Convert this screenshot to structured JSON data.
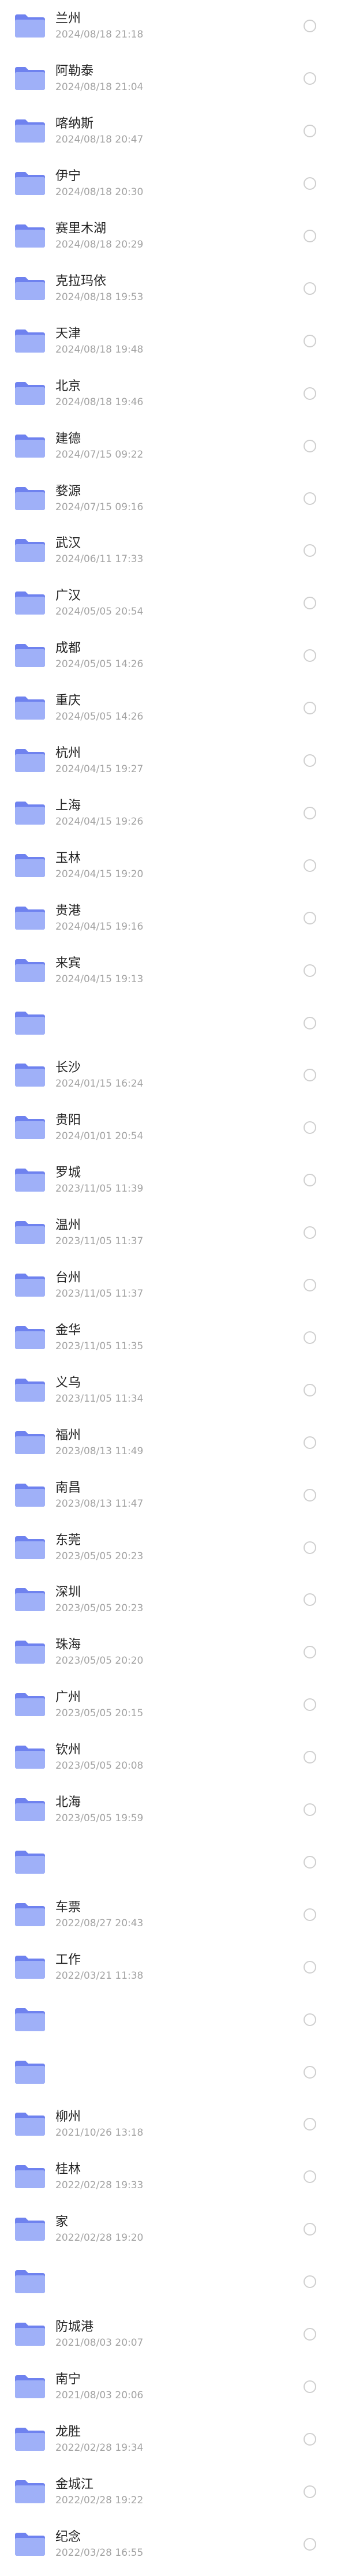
{
  "colors": {
    "folder_back": "#6f82ef",
    "folder_front": "#9fb0f8",
    "title": "#222222",
    "date": "#a3a3a3",
    "radio": "#cfcfcf"
  },
  "items": [
    {
      "name": "兰州",
      "date": "2024/08/18 21:18"
    },
    {
      "name": "阿勒泰",
      "date": "2024/08/18 21:04"
    },
    {
      "name": "喀纳斯",
      "date": "2024/08/18 20:47"
    },
    {
      "name": "伊宁",
      "date": "2024/08/18 20:30"
    },
    {
      "name": "赛里木湖",
      "date": "2024/08/18 20:29"
    },
    {
      "name": "克拉玛依",
      "date": "2024/08/18 19:53"
    },
    {
      "name": "天津",
      "date": "2024/08/18 19:48"
    },
    {
      "name": "北京",
      "date": "2024/08/18 19:46"
    },
    {
      "name": "建德",
      "date": "2024/07/15 09:22"
    },
    {
      "name": "婺源",
      "date": "2024/07/15 09:16"
    },
    {
      "name": "武汉",
      "date": "2024/06/11 17:33"
    },
    {
      "name": "广汉",
      "date": "2024/05/05 20:54"
    },
    {
      "name": "成都",
      "date": "2024/05/05 14:26"
    },
    {
      "name": "重庆",
      "date": "2024/05/05 14:26"
    },
    {
      "name": "杭州",
      "date": "2024/04/15 19:27"
    },
    {
      "name": "上海",
      "date": "2024/04/15 19:26"
    },
    {
      "name": "玉林",
      "date": "2024/04/15 19:20"
    },
    {
      "name": "贵港",
      "date": "2024/04/15 19:16"
    },
    {
      "name": "来宾",
      "date": "2024/04/15 19:13"
    },
    {
      "name": "",
      "date": ""
    },
    {
      "name": "长沙",
      "date": "2024/01/15 16:24"
    },
    {
      "name": "贵阳",
      "date": "2024/01/01 20:54"
    },
    {
      "name": "罗城",
      "date": "2023/11/05 11:39"
    },
    {
      "name": "温州",
      "date": "2023/11/05 11:37"
    },
    {
      "name": "台州",
      "date": "2023/11/05 11:37"
    },
    {
      "name": "金华",
      "date": "2023/11/05 11:35"
    },
    {
      "name": "义乌",
      "date": "2023/11/05 11:34"
    },
    {
      "name": "福州",
      "date": "2023/08/13 11:49"
    },
    {
      "name": "南昌",
      "date": "2023/08/13 11:47"
    },
    {
      "name": "东莞",
      "date": "2023/05/05 20:23"
    },
    {
      "name": "深圳",
      "date": "2023/05/05 20:23"
    },
    {
      "name": "珠海",
      "date": "2023/05/05 20:20"
    },
    {
      "name": "广州",
      "date": "2023/05/05 20:15"
    },
    {
      "name": "钦州",
      "date": "2023/05/05 20:08"
    },
    {
      "name": "北海",
      "date": "2023/05/05 19:59"
    },
    {
      "name": "",
      "date": ""
    },
    {
      "name": "车票",
      "date": "2022/08/27 20:43"
    },
    {
      "name": "工作",
      "date": "2022/03/21 11:38"
    },
    {
      "name": "",
      "date": ""
    },
    {
      "name": "",
      "date": ""
    },
    {
      "name": "柳州",
      "date": "2021/10/26 13:18"
    },
    {
      "name": "桂林",
      "date": "2022/02/28 19:33"
    },
    {
      "name": "家",
      "date": "2022/02/28 19:20"
    },
    {
      "name": "",
      "date": ""
    },
    {
      "name": "防城港",
      "date": "2021/08/03 20:07"
    },
    {
      "name": "南宁",
      "date": "2021/08/03 20:06"
    },
    {
      "name": "龙胜",
      "date": "2022/02/28 19:34"
    },
    {
      "name": "金城江",
      "date": "2022/02/28 19:22"
    },
    {
      "name": "纪念",
      "date": "2022/03/28 16:55"
    }
  ]
}
